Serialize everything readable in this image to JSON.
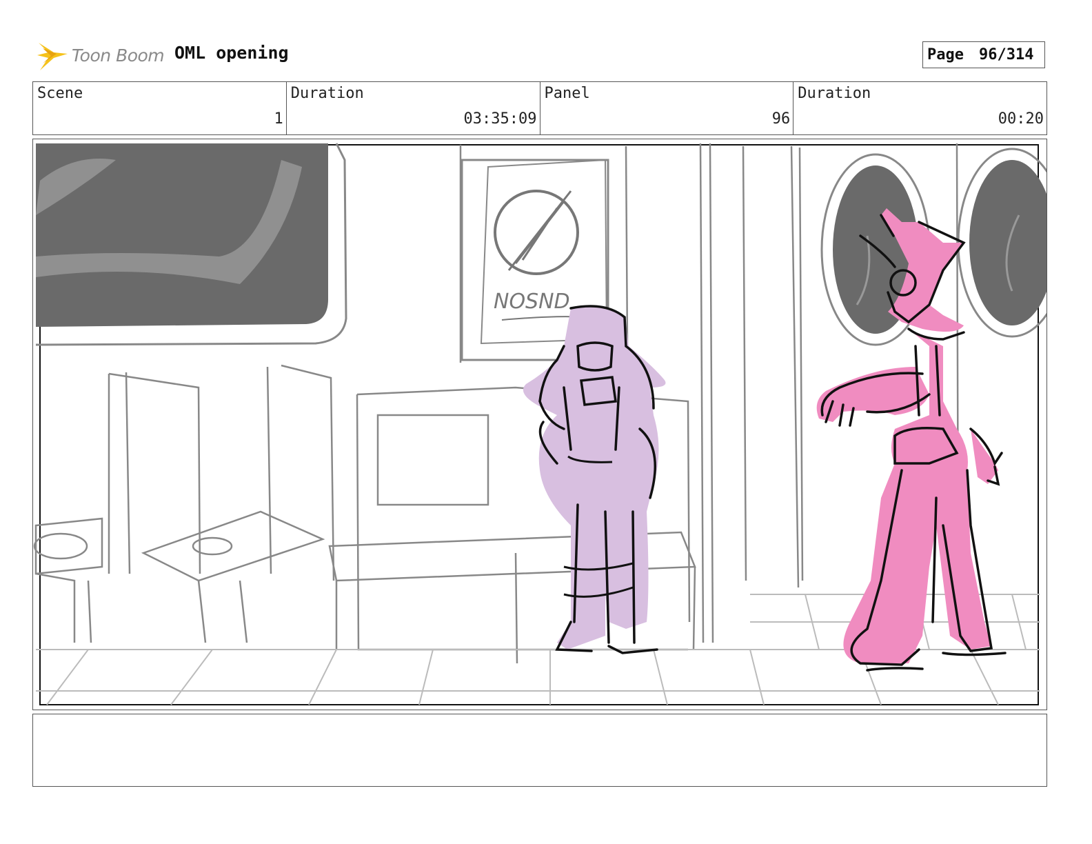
{
  "header": {
    "logo_text": "Toon Boom",
    "project_title": "OML opening",
    "page_label": "Page",
    "page_number": "96/314"
  },
  "info": {
    "scene_label": "Scene",
    "scene_value": "1",
    "duration_label": "Duration",
    "duration_value": "03:35:09",
    "panel_label": "Panel",
    "panel_value": "96",
    "panel_duration_label": "Duration",
    "panel_duration_value": "00:20"
  },
  "poster_text": "NOSND",
  "notes": "",
  "colors": {
    "character_left": "#d8bfe0",
    "character_right": "#f08cc0",
    "sketch_gray": "#777777",
    "window_dark": "#6a6a6a",
    "logo_accent": "#f5c21b"
  }
}
